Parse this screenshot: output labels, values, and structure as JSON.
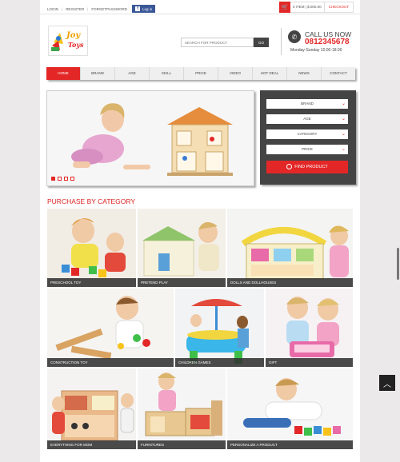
{
  "topbar": {
    "login": "LOGIN",
    "register": "REGISTER",
    "forget": "FORGETPASSWORD",
    "fb_label": "Log in",
    "cart_text": "0 ITEM | $.000.00",
    "checkout": "CHECKOUT"
  },
  "search": {
    "placeholder": "SEARCH FOR PRODUCT",
    "button": "GO"
  },
  "contact": {
    "title": "CALL US NOW",
    "phone": "0812345678",
    "hours": "Monday-Sunday 10.00-18.00"
  },
  "logo": {
    "line1": "Joy",
    "line2": "Toys"
  },
  "nav": [
    "HOME",
    "BRAND",
    "AGE",
    "SKILL",
    "PRICE",
    "VIDEO",
    "HOT DEAL",
    "NEWS",
    "CONTACT"
  ],
  "finder": {
    "brand": "BRAND",
    "age": "AGE",
    "category": "CATEGORY",
    "price": "PRICE",
    "button": "FIND PRODUCT"
  },
  "section_title": "PURCHASE BY CATEGORY",
  "categories": [
    "PRESCHOOL TOY",
    "PRETEND PLAY",
    "DOLLS AND DOLLHOUSES",
    "CONSTRUCTION TOY",
    "CHILDREN GAMES",
    "GIFT",
    "EVERYTHING FOR MOM",
    "FURNITURES",
    "PERSONALIZE A PRODUCT"
  ],
  "colors": {
    "accent": "#e32727",
    "dark": "#444444"
  }
}
